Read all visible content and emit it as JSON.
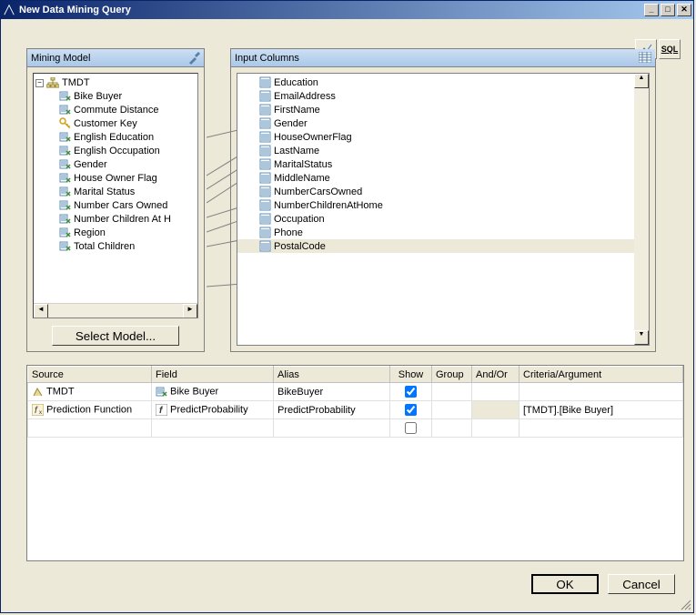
{
  "title": "New Data Mining Query",
  "toolbar": {
    "design_tip": "Design",
    "sql_tip": "SQL",
    "sql_label": "SQL"
  },
  "mining_model": {
    "header": "Mining Model",
    "root": "TMDT",
    "items": [
      {
        "name": "Bike Buyer",
        "kind": "attr"
      },
      {
        "name": "Commute Distance",
        "kind": "attr"
      },
      {
        "name": "Customer Key",
        "kind": "key"
      },
      {
        "name": "English Education",
        "kind": "attr"
      },
      {
        "name": "English Occupation",
        "kind": "attr"
      },
      {
        "name": "Gender",
        "kind": "attr"
      },
      {
        "name": "House Owner Flag",
        "kind": "attr"
      },
      {
        "name": "Marital Status",
        "kind": "attr"
      },
      {
        "name": "Number Cars Owned",
        "kind": "attr"
      },
      {
        "name": "Number Children At H",
        "kind": "attr"
      },
      {
        "name": "Region",
        "kind": "attr"
      },
      {
        "name": "Total Children",
        "kind": "attr"
      }
    ],
    "select_button": "Select Model..."
  },
  "input_columns": {
    "header": "Input Columns",
    "items": [
      "Education",
      "EmailAddress",
      "FirstName",
      "Gender",
      "HouseOwnerFlag",
      "LastName",
      "MaritalStatus",
      "MiddleName",
      "NumberCarsOwned",
      "NumberChildrenAtHome",
      "Occupation",
      "Phone",
      "PostalCode"
    ],
    "selected_index": 12
  },
  "grid": {
    "headers": {
      "source": "Source",
      "field": "Field",
      "alias": "Alias",
      "show": "Show",
      "group": "Group",
      "andor": "And/Or",
      "criteria": "Criteria/Argument"
    },
    "rows": [
      {
        "source": "TMDT",
        "src_icon": "model",
        "field": "Bike Buyer",
        "fld_icon": "attr",
        "alias": "BikeBuyer",
        "show": true,
        "group": "",
        "andor": "",
        "criteria": ""
      },
      {
        "source": "Prediction Function",
        "src_icon": "fx",
        "field": "PredictProbability",
        "fld_icon": "fn",
        "alias": "PredictProbability",
        "show": true,
        "group": "",
        "andor": "",
        "criteria": "[TMDT].[Bike Buyer]"
      },
      {
        "source": "",
        "src_icon": "",
        "field": "",
        "fld_icon": "",
        "alias": "",
        "show": false,
        "group": "",
        "andor": "",
        "criteria": ""
      }
    ]
  },
  "buttons": {
    "ok": "OK",
    "cancel": "Cancel"
  }
}
